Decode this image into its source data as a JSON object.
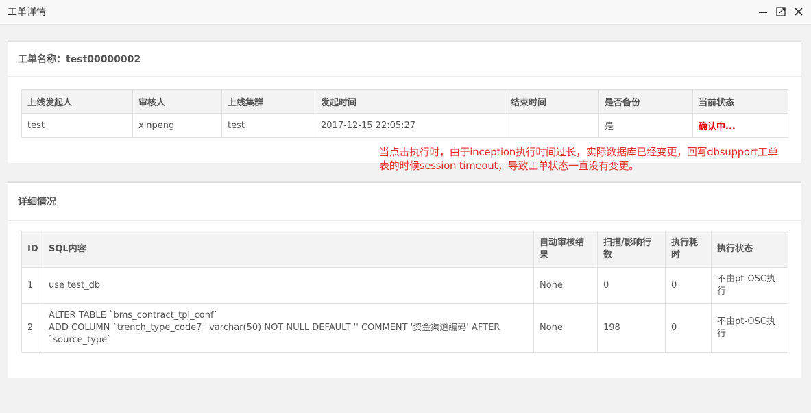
{
  "window": {
    "title": "工单详情"
  },
  "order": {
    "name_label": "工单名称：test00000002",
    "headers": [
      "上线发起人",
      "审核人",
      "上线集群",
      "发起时间",
      "结束时间",
      "是否备份",
      "当前状态"
    ],
    "row": {
      "initiator": "test",
      "reviewer": "xinpeng",
      "cluster": "test",
      "start_time": "2017-12-15 22:05:27",
      "end_time": "",
      "backup": "是",
      "status": "确认中..."
    }
  },
  "annotation": {
    "line1": "当点击执行时，由于inception执行时间过长，实际数据库已经变更，回写dbsupport工单",
    "line2": "表的时候session timeout，导致工单状态一直没有变更。"
  },
  "detail": {
    "title": "详细情况",
    "headers": {
      "id": "ID",
      "sql": "SQL内容",
      "auto_review": "自动审核结果",
      "scan_affect": "扫描/影响行数",
      "exec_time": "执行耗时",
      "exec_status": "执行状态"
    },
    "rows": [
      {
        "id": "1",
        "sql_lines": [
          "use test_db"
        ],
        "auto_review": "None",
        "scan_affect": "0",
        "exec_time": "0",
        "exec_status": "不由pt-OSC执行"
      },
      {
        "id": "2",
        "sql_lines": [
          "ALTER TABLE `bms_contract_tpl_conf`",
          "ADD COLUMN `trench_type_code7` varchar(50) NOT NULL DEFAULT '' COMMENT '资金渠道编码' AFTER",
          "`source_type`"
        ],
        "auto_review": "None",
        "scan_affect": "198",
        "exec_time": "0",
        "exec_status": "不由pt-OSC执行"
      }
    ]
  },
  "colors": {
    "accent_red": "#e00000",
    "annotation_red": "#e03030"
  }
}
